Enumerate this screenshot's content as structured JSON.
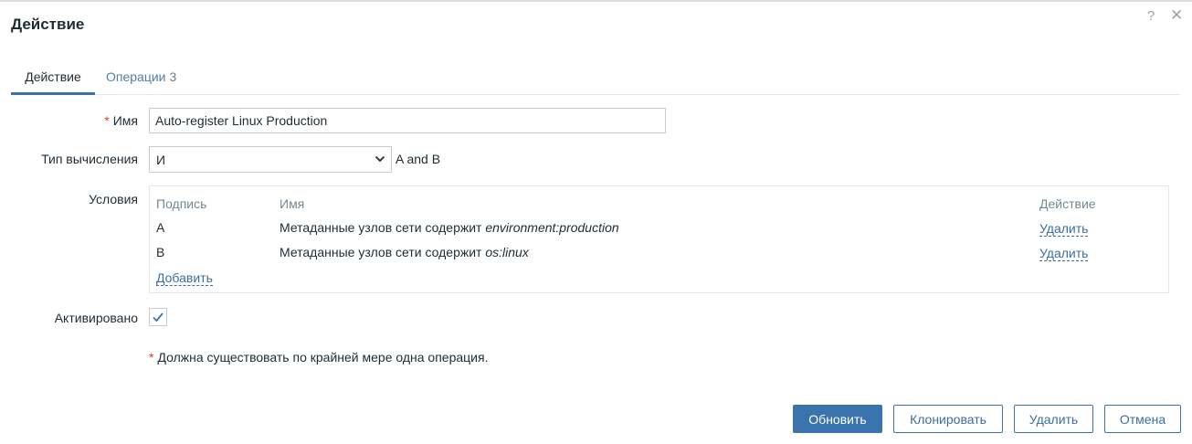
{
  "dialog": {
    "title": "Действие",
    "help_icon": "?",
    "close_icon": "✕"
  },
  "tabs": [
    {
      "label": "Действие",
      "active": true
    },
    {
      "label": "Операции",
      "count": "3",
      "active": false
    }
  ],
  "form": {
    "name_label": "Имя",
    "required_mark": "*",
    "name_value": "Auto-register Linux Production",
    "calc_label": "Тип вычисления",
    "calc_value": "И",
    "formula": "A and B",
    "conditions_label": "Условия",
    "conditions": {
      "headers": [
        "Подпись",
        "Имя",
        "Действие"
      ],
      "rows": [
        {
          "label": "A",
          "text": "Метаданные узлов сети содержит ",
          "value": "environment:production",
          "action": "Удалить"
        },
        {
          "label": "B",
          "text": "Метаданные узлов сети содержит ",
          "value": "os:linux",
          "action": "Удалить"
        }
      ],
      "add_label": "Добавить"
    },
    "enabled_label": "Активировано",
    "enabled": true,
    "note": "Должна существовать по крайней мере одна операция."
  },
  "buttons": {
    "update": "Обновить",
    "clone": "Клонировать",
    "delete": "Удалить",
    "cancel": "Отмена"
  },
  "colors": {
    "accent": "#3b74ad",
    "link": "#3b6ea1",
    "required": "#d2452d"
  }
}
